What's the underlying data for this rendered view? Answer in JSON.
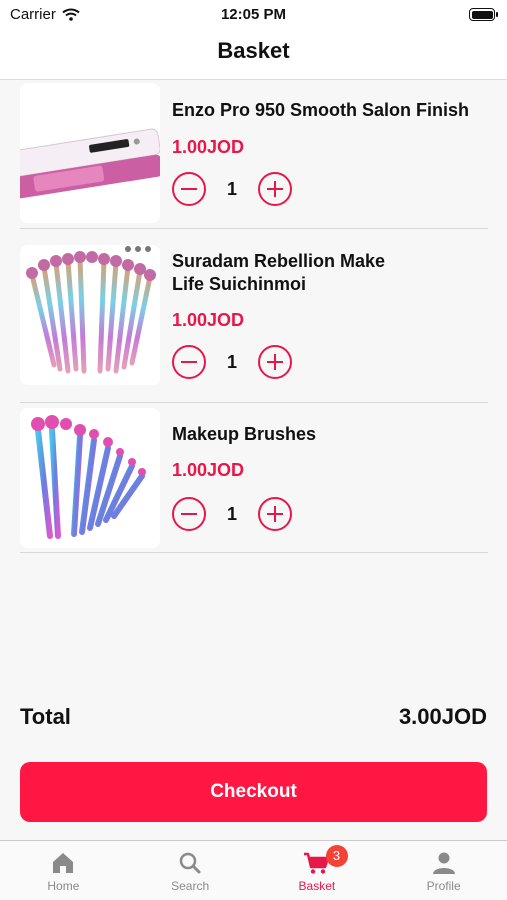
{
  "status_bar": {
    "carrier": "Carrier",
    "time": "12:05 PM"
  },
  "nav": {
    "title": "Basket"
  },
  "cart": {
    "items": [
      {
        "name": "Enzo Pro 950 Smooth Salon Finish",
        "price": "1.00JOD",
        "quantity": "1"
      },
      {
        "name": "Suradam Rebellion Make Life Suichinmoi",
        "price": "1.00JOD",
        "quantity": "1"
      },
      {
        "name": "Makeup Brushes",
        "price": "1.00JOD",
        "quantity": "1"
      }
    ]
  },
  "summary": {
    "total_label": "Total",
    "total_value": "3.00JOD"
  },
  "checkout": {
    "label": "Checkout"
  },
  "tabs": [
    {
      "label": "Home",
      "icon": "home-icon"
    },
    {
      "label": "Search",
      "icon": "search-icon"
    },
    {
      "label": "Basket",
      "icon": "cart-icon",
      "badge": "3"
    },
    {
      "label": "Profile",
      "icon": "person-icon"
    }
  ],
  "colors": {
    "accent": "#e8174a",
    "checkout_bg": "#ff1744",
    "badge": "#f44336"
  }
}
